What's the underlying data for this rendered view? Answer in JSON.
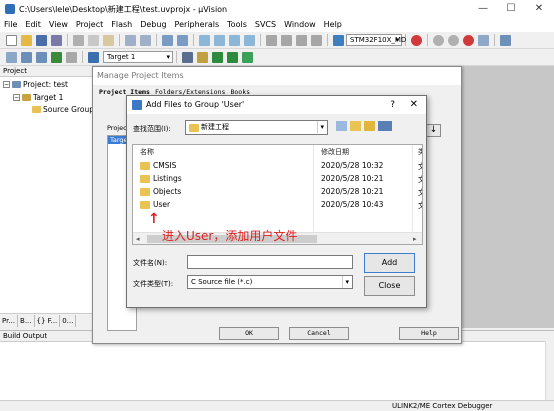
{
  "window": {
    "title": "C:\\Users\\lele\\Desktop\\新建工程\\test.uvprojx - µVision",
    "min": "—",
    "max": "☐",
    "close": "✕"
  },
  "menu": [
    "File",
    "Edit",
    "View",
    "Project",
    "Flash",
    "Debug",
    "Peripherals",
    "Tools",
    "SVCS",
    "Window",
    "Help"
  ],
  "toolbar": {
    "device_select": "STM32F10X_MD",
    "target_select": "Target 1"
  },
  "project_panel": {
    "header": "Project",
    "root": "Project: test",
    "target": "Target 1",
    "group": "Source Group",
    "tabs": [
      "Pr...",
      "B...",
      "{} F...",
      "0..."
    ]
  },
  "build_output": {
    "header": "Build Output"
  },
  "statusbar": {
    "debugger": "ULINK2/ME Cortex Debugger"
  },
  "manage_dialog": {
    "title": "Manage Project Items",
    "tabs": [
      "Project Items",
      "Folders/Extensions",
      "Books"
    ],
    "partial_label": "Projec",
    "partial_item": "Targe",
    "ok": "OK",
    "cancel": "Cancel",
    "help": "Help"
  },
  "add_dialog": {
    "title": "Add Files to Group 'User'",
    "help_glyph": "?",
    "close_glyph": "✕",
    "lookin_label": "查找范围(I):",
    "lookin_value": "新建工程",
    "columns": {
      "name": "名称",
      "date": "修改日期",
      "type": "类"
    },
    "files": [
      {
        "name": "CMSIS",
        "date": "2020/5/28 10:32",
        "type": "文"
      },
      {
        "name": "Listings",
        "date": "2020/5/28 10:21",
        "type": "文"
      },
      {
        "name": "Objects",
        "date": "2020/5/28 10:21",
        "type": "文"
      },
      {
        "name": "User",
        "date": "2020/5/28 10:43",
        "type": "文"
      }
    ],
    "filename_label": "文件名(N):",
    "filename_value": "",
    "filetype_label": "文件类型(T):",
    "filetype_value": "C Source file (*.c)",
    "add_button": "Add",
    "close_button": "Close"
  },
  "annotation": {
    "text": "进入User，添加用户文件",
    "arrow": "↑",
    "color": "#e02020"
  }
}
